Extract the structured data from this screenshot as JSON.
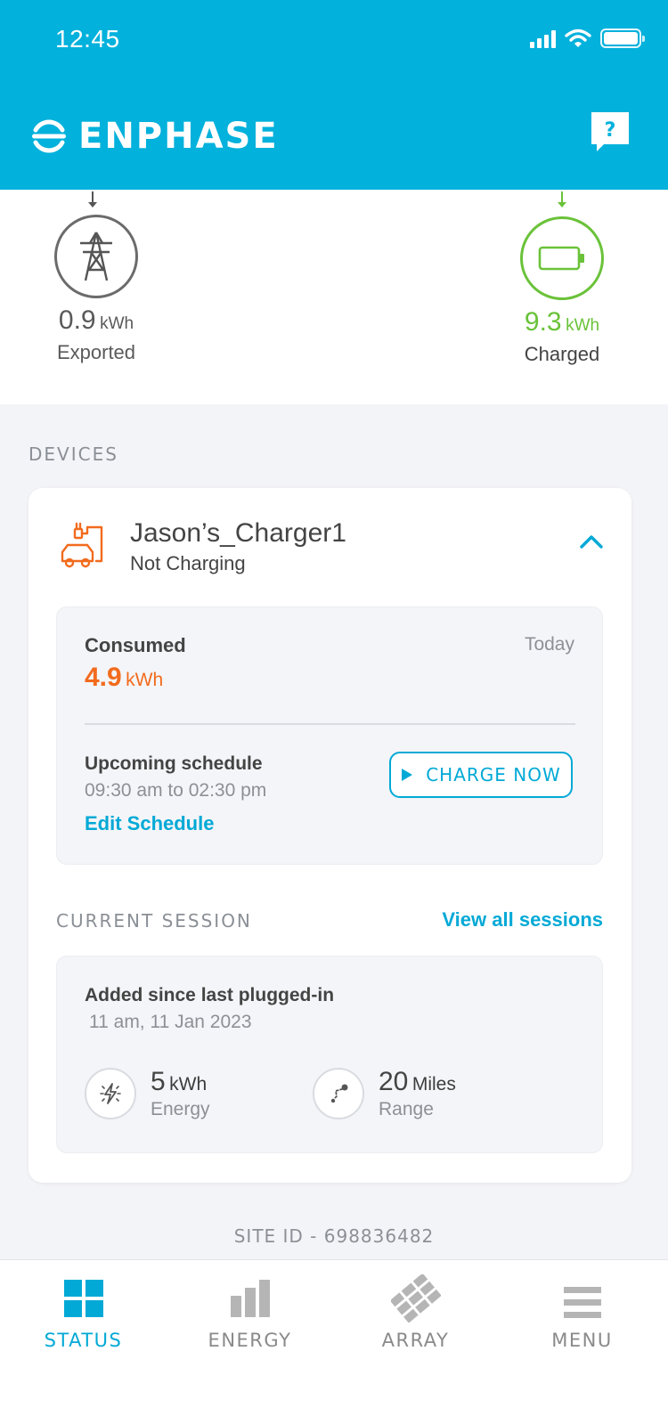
{
  "status_bar": {
    "time": "12:45"
  },
  "header": {
    "brand": "ENPHASE",
    "help_label": "?"
  },
  "summary": {
    "exported": {
      "value": "0.9",
      "unit": "kWh",
      "label": "Exported",
      "color": "#5a5a5a"
    },
    "charged": {
      "value": "9.3",
      "unit": "kWh",
      "label": "Charged",
      "color": "#6ac239"
    }
  },
  "devices": {
    "section_label": "DEVICES",
    "charger": {
      "name": "Jason’s_Charger1",
      "status": "Not Charging",
      "consumed_label": "Consumed",
      "period": "Today",
      "consumed_value": "4.9",
      "consumed_unit": "kWh",
      "schedule_label": "Upcoming schedule",
      "schedule_time": "09:30 am to 02:30 pm",
      "edit_schedule": "Edit Schedule",
      "charge_now": "CHARGE NOW"
    },
    "session": {
      "section_label": "CURRENT SESSION",
      "view_all": "View all sessions",
      "title": "Added since last plugged-in",
      "date": "11 am, 11 Jan 2023",
      "energy": {
        "value": "5",
        "unit": "kWh",
        "label": "Energy"
      },
      "range": {
        "value": "20",
        "unit": "Miles",
        "label": "Range"
      }
    }
  },
  "site_id": "SITE ID - 698836482",
  "tabs": [
    {
      "label": "STATUS",
      "icon": "grid-icon",
      "active": true
    },
    {
      "label": "ENERGY",
      "icon": "bar-chart-icon",
      "active": false
    },
    {
      "label": "ARRAY",
      "icon": "solar-array-icon",
      "active": false
    },
    {
      "label": "MENU",
      "icon": "hamburger-icon",
      "active": false
    }
  ],
  "colors": {
    "brand": "#02b1dc",
    "accent": "#02a9d6",
    "orange": "#f26b1d",
    "green": "#6ac239"
  }
}
